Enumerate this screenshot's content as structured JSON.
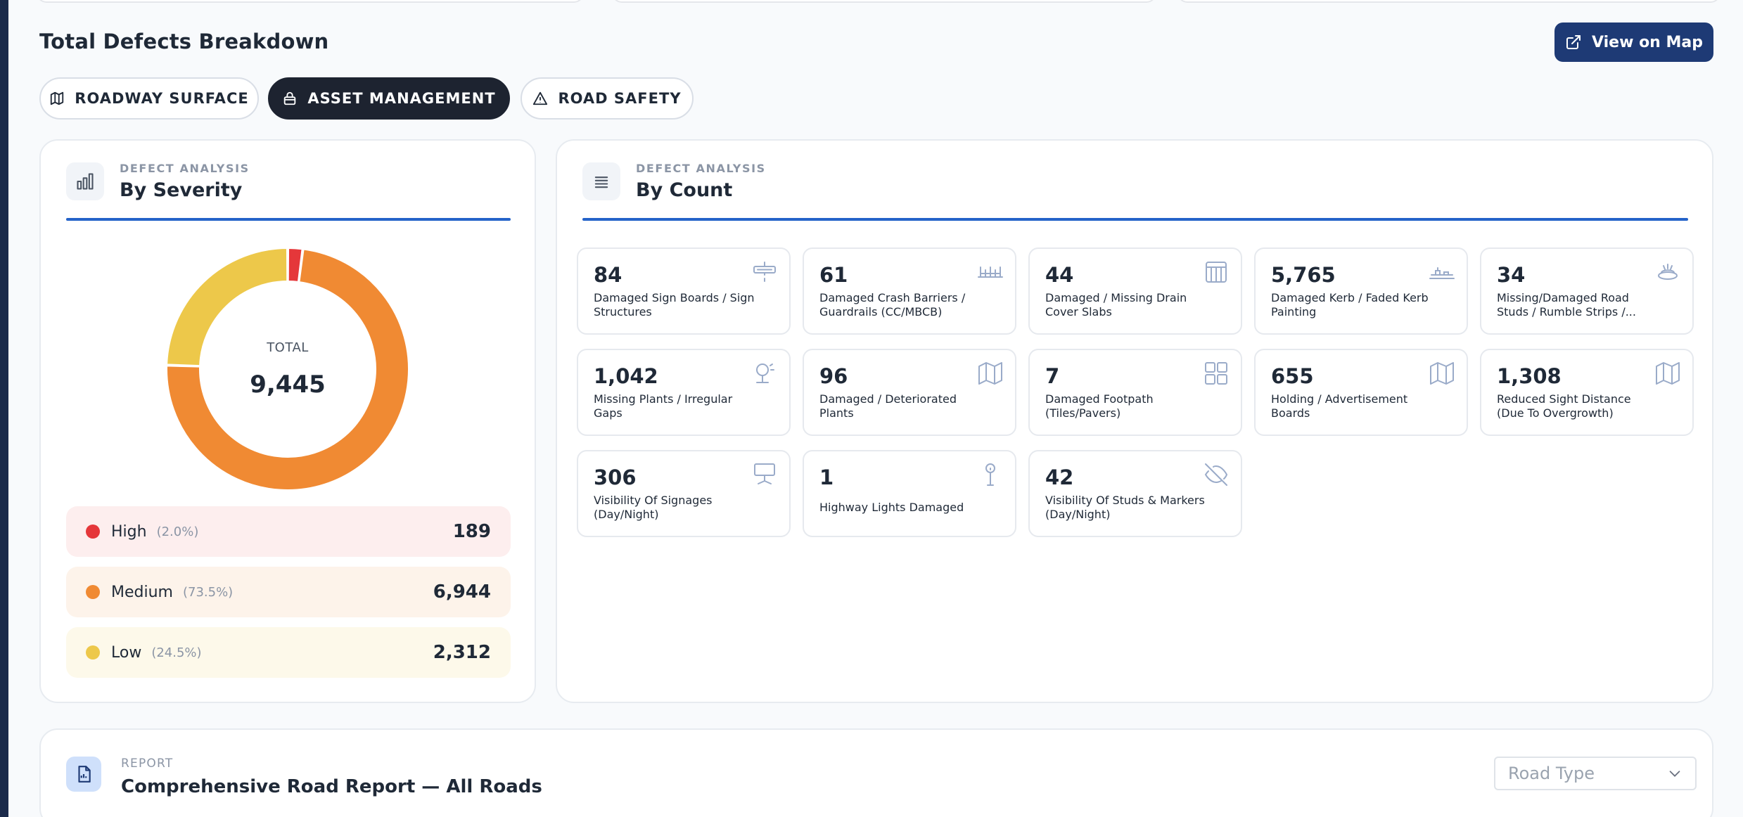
{
  "header": {
    "title": "Total Defects Breakdown",
    "map_button": "View on Map"
  },
  "tabs": [
    {
      "label": "ROADWAY SURFACE",
      "icon": "map-icon",
      "active": false
    },
    {
      "label": "ASSET MANAGEMENT",
      "icon": "lock-icon",
      "active": true
    },
    {
      "label": "ROAD SAFETY",
      "icon": "warning-icon",
      "active": false
    }
  ],
  "severity_panel": {
    "kicker": "DEFECT ANALYSIS",
    "title": "By Severity",
    "total_label": "TOTAL",
    "total_value": "9,445",
    "rows": [
      {
        "name": "High",
        "pct": "(2.0%)",
        "value": "189",
        "color": "#e5373a",
        "bg": "#fdeeee"
      },
      {
        "name": "Medium",
        "pct": "(73.5%)",
        "value": "6,944",
        "color": "#f08a33",
        "bg": "#fdf3ea"
      },
      {
        "name": "Low",
        "pct": "(24.5%)",
        "value": "2,312",
        "color": "#edc84a",
        "bg": "#fdf9ea"
      }
    ]
  },
  "chart_data": {
    "type": "pie",
    "donut": true,
    "categories": [
      "High",
      "Medium",
      "Low"
    ],
    "values": [
      189,
      6944,
      2312
    ],
    "colors": [
      "#e5373a",
      "#f08a33",
      "#edc84a"
    ],
    "total": 9445
  },
  "count_panel": {
    "kicker": "DEFECT ANALYSIS",
    "title": "By Count",
    "tiles": [
      {
        "value": "84",
        "label": "Damaged Sign Boards / Sign Structures",
        "icon": "signboard-icon"
      },
      {
        "value": "61",
        "label": "Damaged Crash Barriers / Guardrails (CC/MBCB)",
        "icon": "barrier-icon"
      },
      {
        "value": "44",
        "label": "Damaged / Missing Drain Cover Slabs",
        "icon": "grid-icon"
      },
      {
        "value": "5,765",
        "label": "Damaged Kerb / Faded Kerb Painting",
        "icon": "kerb-icon"
      },
      {
        "value": "34",
        "label": "Missing/Damaged Road Studs / Rumble Strips /...",
        "icon": "road-stud-icon"
      },
      {
        "value": "1,042",
        "label": "Missing Plants / Irregular Gaps",
        "icon": "plant-icon"
      },
      {
        "value": "96",
        "label": "Damaged / Deteriorated Plants",
        "icon": "map-icon"
      },
      {
        "value": "7",
        "label": "Damaged Footpath (Tiles/Pavers)",
        "icon": "tiles-icon"
      },
      {
        "value": "655",
        "label": "Holding / Advertisement Boards",
        "icon": "map-icon"
      },
      {
        "value": "1,308",
        "label": "Reduced Sight Distance (Due To Overgrowth)",
        "icon": "map-icon"
      },
      {
        "value": "306",
        "label": "Visibility Of Signages (Day/Night)",
        "icon": "monitor-icon"
      },
      {
        "value": "1",
        "label": "Highway Lights Damaged",
        "icon": "light-pole-icon"
      },
      {
        "value": "42",
        "label": "Visibility Of Studs & Markers (Day/Night)",
        "icon": "eye-off-icon"
      }
    ]
  },
  "report": {
    "kicker": "REPORT",
    "title": "Comprehensive Road Report — All Roads",
    "road_type_placeholder": "Road Type"
  }
}
